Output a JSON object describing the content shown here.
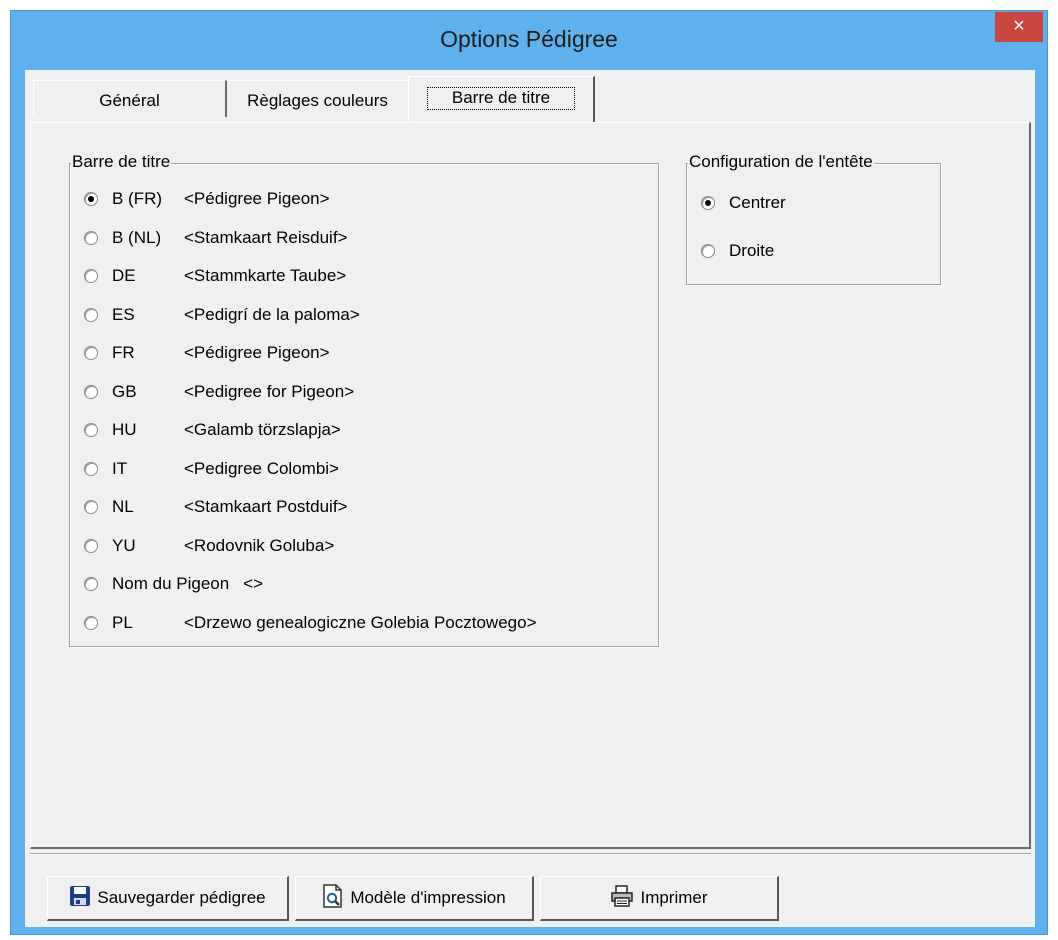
{
  "window": {
    "title": "Options Pédigree",
    "close_label": "×"
  },
  "tabs": [
    {
      "label": "Général",
      "selected": false
    },
    {
      "label": "Règlages couleurs",
      "selected": false
    },
    {
      "label": "Barre de titre",
      "selected": true
    }
  ],
  "title_group": {
    "legend": "Barre de titre",
    "options": [
      {
        "code": "B (FR)",
        "name": "<Pédigree Pigeon>",
        "checked": true
      },
      {
        "code": "B (NL)",
        "name": "<Stamkaart Reisduif>",
        "checked": false
      },
      {
        "code": "DE",
        "name": "<Stammkarte Taube>",
        "checked": false
      },
      {
        "code": "ES",
        "name": "<Pedigrí de la paloma>",
        "checked": false
      },
      {
        "code": "FR",
        "name": "<Pédigree Pigeon>",
        "checked": false
      },
      {
        "code": "GB",
        "name": "<Pedigree for Pigeon>",
        "checked": false
      },
      {
        "code": "HU",
        "name": "<Galamb törzslapja>",
        "checked": false
      },
      {
        "code": "IT",
        "name": "<Pedigree Colombi>",
        "checked": false
      },
      {
        "code": "NL",
        "name": "<Stamkaart Postduif>",
        "checked": false
      },
      {
        "code": "YU",
        "name": "<Rodovnik Goluba>",
        "checked": false
      },
      {
        "code": "Nom du Pigeon",
        "name": "<>",
        "checked": false
      },
      {
        "code": "PL",
        "name": "<Drzewo genealogiczne Golebia Pocztowego>",
        "checked": false
      }
    ]
  },
  "header_group": {
    "legend": "Configuration de l'entête",
    "options": [
      {
        "label": "Centrer",
        "checked": true
      },
      {
        "label": "Droite",
        "checked": false
      }
    ]
  },
  "buttons": {
    "save": {
      "label": "Sauvegarder pédigree",
      "icon": "floppy-disk-icon"
    },
    "template": {
      "label": "Modèle d'impression",
      "icon": "print-preview-icon"
    },
    "print": {
      "label": "Imprimer",
      "icon": "printer-icon"
    }
  },
  "colors": {
    "title_bar": "#5fb1ed",
    "close_button": "#c7463f",
    "dialog_bg": "#f0f0f0"
  }
}
